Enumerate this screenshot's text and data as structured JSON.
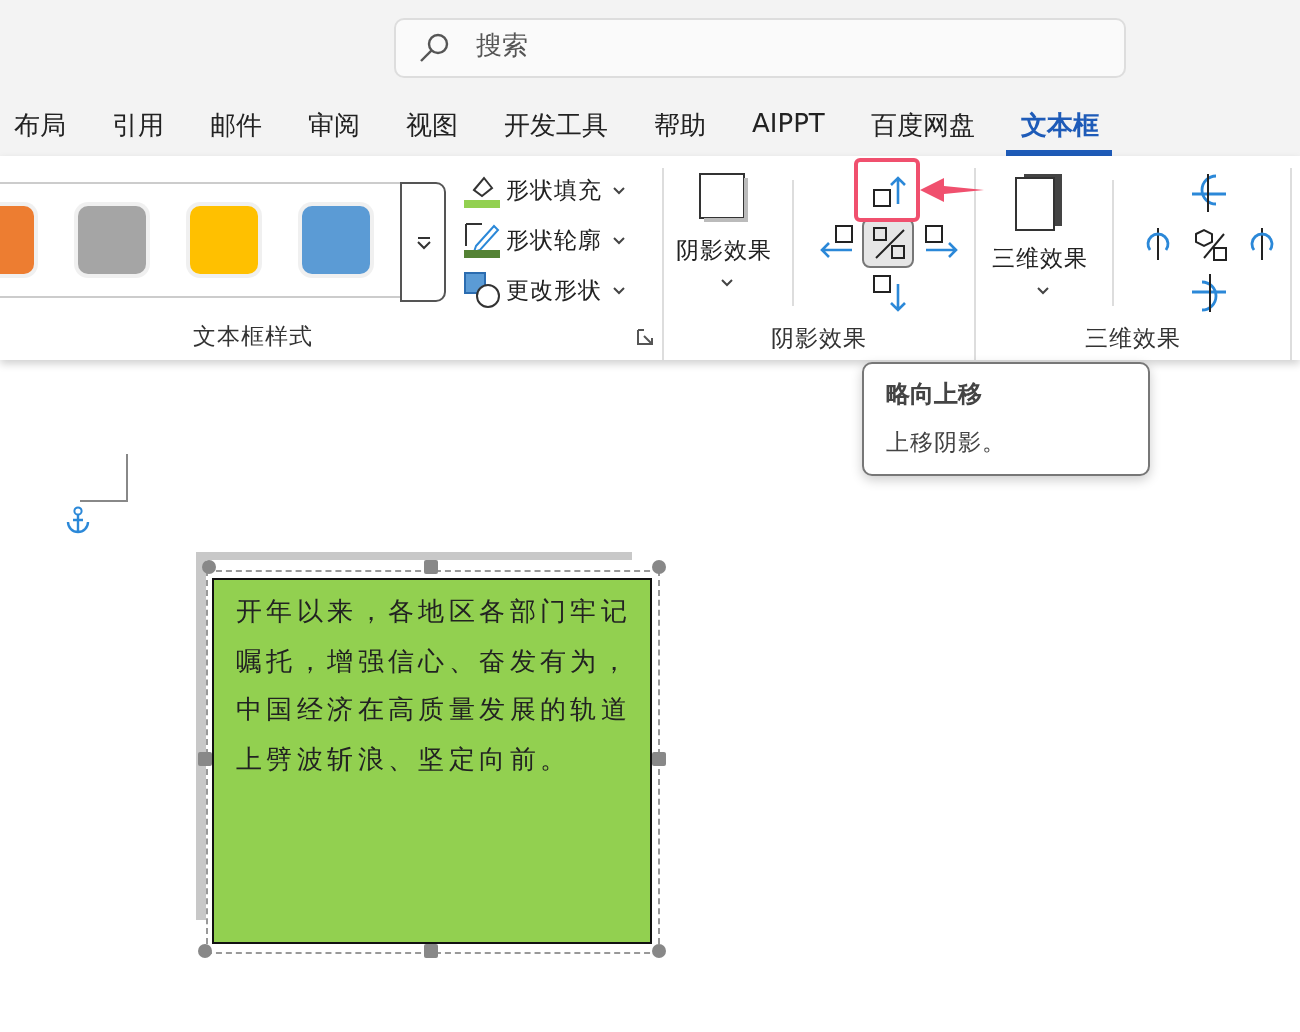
{
  "search": {
    "placeholder": "搜索"
  },
  "tabs": [
    {
      "label": "布局",
      "selected": false
    },
    {
      "label": "引用",
      "selected": false
    },
    {
      "label": "邮件",
      "selected": false
    },
    {
      "label": "审阅",
      "selected": false
    },
    {
      "label": "视图",
      "selected": false
    },
    {
      "label": "开发工具",
      "selected": false
    },
    {
      "label": "帮助",
      "selected": false
    },
    {
      "label": "AIPPT",
      "selected": false
    },
    {
      "label": "百度网盘",
      "selected": false
    },
    {
      "label": "文本框",
      "selected": true
    }
  ],
  "ribbon": {
    "style_group": {
      "label": "文本框样式",
      "swatches": [
        {
          "color": "#ed7d31"
        },
        {
          "color": "#a5a5a5"
        },
        {
          "color": "#ffc000"
        },
        {
          "color": "#5b9bd5"
        }
      ],
      "commands": [
        {
          "kind": "fill",
          "label": "形状填充"
        },
        {
          "kind": "outline",
          "label": "形状轮廓"
        },
        {
          "kind": "change",
          "label": "更改形状"
        }
      ]
    },
    "shadow_group": {
      "label": "阴影效果",
      "button": "阴影效果",
      "nudges": [
        {
          "kind": "up",
          "selected": false
        },
        {
          "kind": "left",
          "selected": false
        },
        {
          "kind": "toggle",
          "selected": true
        },
        {
          "kind": "right",
          "selected": false
        },
        {
          "kind": "down",
          "selected": false
        }
      ]
    },
    "three_d_group": {
      "label": "三维效果",
      "button": "三维效果",
      "tilts": [
        {
          "kind": "up"
        },
        {
          "kind": "left"
        },
        {
          "kind": "toggle"
        },
        {
          "kind": "right"
        },
        {
          "kind": "down"
        }
      ]
    }
  },
  "tooltip": {
    "title": "略向上移",
    "text": "上移阴影。"
  },
  "textbox": {
    "text": "开年以来，各地区各部门牢记嘱托，增强信心、奋发有为，中国经济在高质量发展的轨道上劈波斩浪、坚定向前。"
  }
}
